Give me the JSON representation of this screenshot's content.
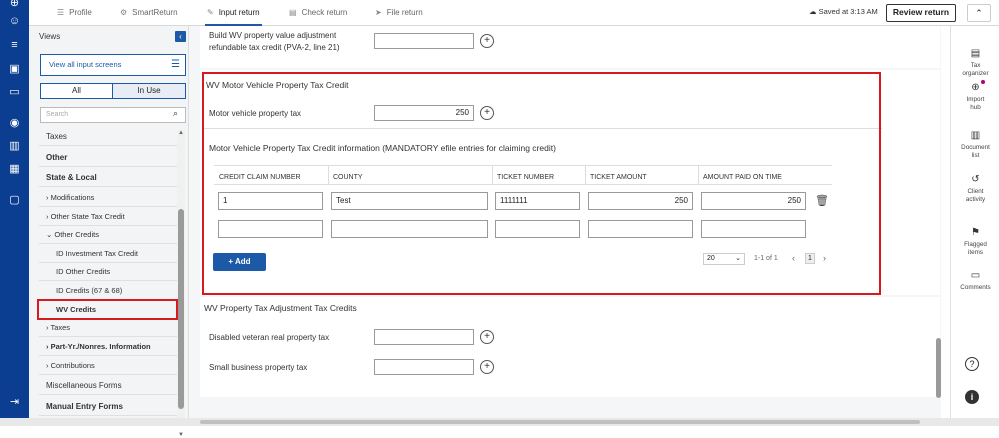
{
  "topnav": {
    "tabs": [
      {
        "label": "Profile",
        "icon": "list-icon"
      },
      {
        "label": "SmartReturn",
        "icon": "gear-icon"
      },
      {
        "label": "Input return",
        "icon": "pencil-icon"
      },
      {
        "label": "Check return",
        "icon": "calendar-icon"
      },
      {
        "label": "File return",
        "icon": "send-icon"
      }
    ],
    "saved": "Saved at 3:13 AM",
    "review_label": "Review return"
  },
  "views": {
    "title": "Views",
    "view_all": "View all input screens",
    "seg_all": "All",
    "seg_inuse": "In Use",
    "search_placeholder": "Search",
    "items": [
      {
        "label": "Taxes"
      },
      {
        "label": "Other"
      },
      {
        "label": "State & Local"
      },
      {
        "label": "Modifications"
      },
      {
        "label": "Other State Tax Credit"
      },
      {
        "label": "Other Credits"
      },
      {
        "label": "ID Investment Tax Credit"
      },
      {
        "label": "ID Other Credits"
      },
      {
        "label": "ID Credits (67 & 68)"
      },
      {
        "label": "WV Credits"
      },
      {
        "label": "Taxes"
      },
      {
        "label": "Part-Yr./Nonres. Information"
      },
      {
        "label": "Contributions"
      },
      {
        "label": "Miscellaneous Forms"
      },
      {
        "label": "Manual Entry Forms"
      }
    ]
  },
  "main": {
    "build_label_1": "Build WV property value adjustment",
    "build_label_2": "refundable tax credit (PVA-2, line 21)",
    "section1_title": "WV Motor Vehicle Property Tax Credit",
    "mv_label": "Motor vehicle property tax",
    "mv_value": "250",
    "info_title": "Motor Vehicle Property Tax Credit information (MANDATORY efile entries for claiming credit)",
    "columns": [
      "CREDIT CLAIM NUMBER",
      "COUNTY",
      "TICKET NUMBER",
      "TICKET AMOUNT",
      "AMOUNT PAID ON TIME"
    ],
    "rows": [
      [
        "1",
        "Test",
        "1111111",
        "250",
        "250"
      ],
      [
        "",
        "",
        "",
        "",
        ""
      ]
    ],
    "add_label": "Add",
    "page_size": "20",
    "pagination": "1-1 of 1",
    "current_page": "1",
    "section2_title": "WV Property Tax Adjustment Tax Credits",
    "disabled_label": "Disabled veteran real property tax",
    "small_label": "Small business property tax"
  },
  "right": {
    "items": [
      {
        "label_1": "Tax",
        "label_2": "organizer",
        "icon": "document-icon"
      },
      {
        "label_1": "Import",
        "label_2": "hub",
        "icon": "import-icon"
      },
      {
        "label_1": "Document",
        "label_2": "list",
        "icon": "folder-icon"
      },
      {
        "label_1": "Client",
        "label_2": "activity",
        "icon": "history-icon"
      },
      {
        "label_1": "Flagged",
        "label_2": "items",
        "icon": "flag-icon"
      },
      {
        "label_1": "Comments",
        "label_2": "",
        "icon": "comment-icon"
      }
    ]
  },
  "colors": {
    "brand": "#0b3d91",
    "accent": "#1c5aa8",
    "highlight": "#d71920"
  }
}
